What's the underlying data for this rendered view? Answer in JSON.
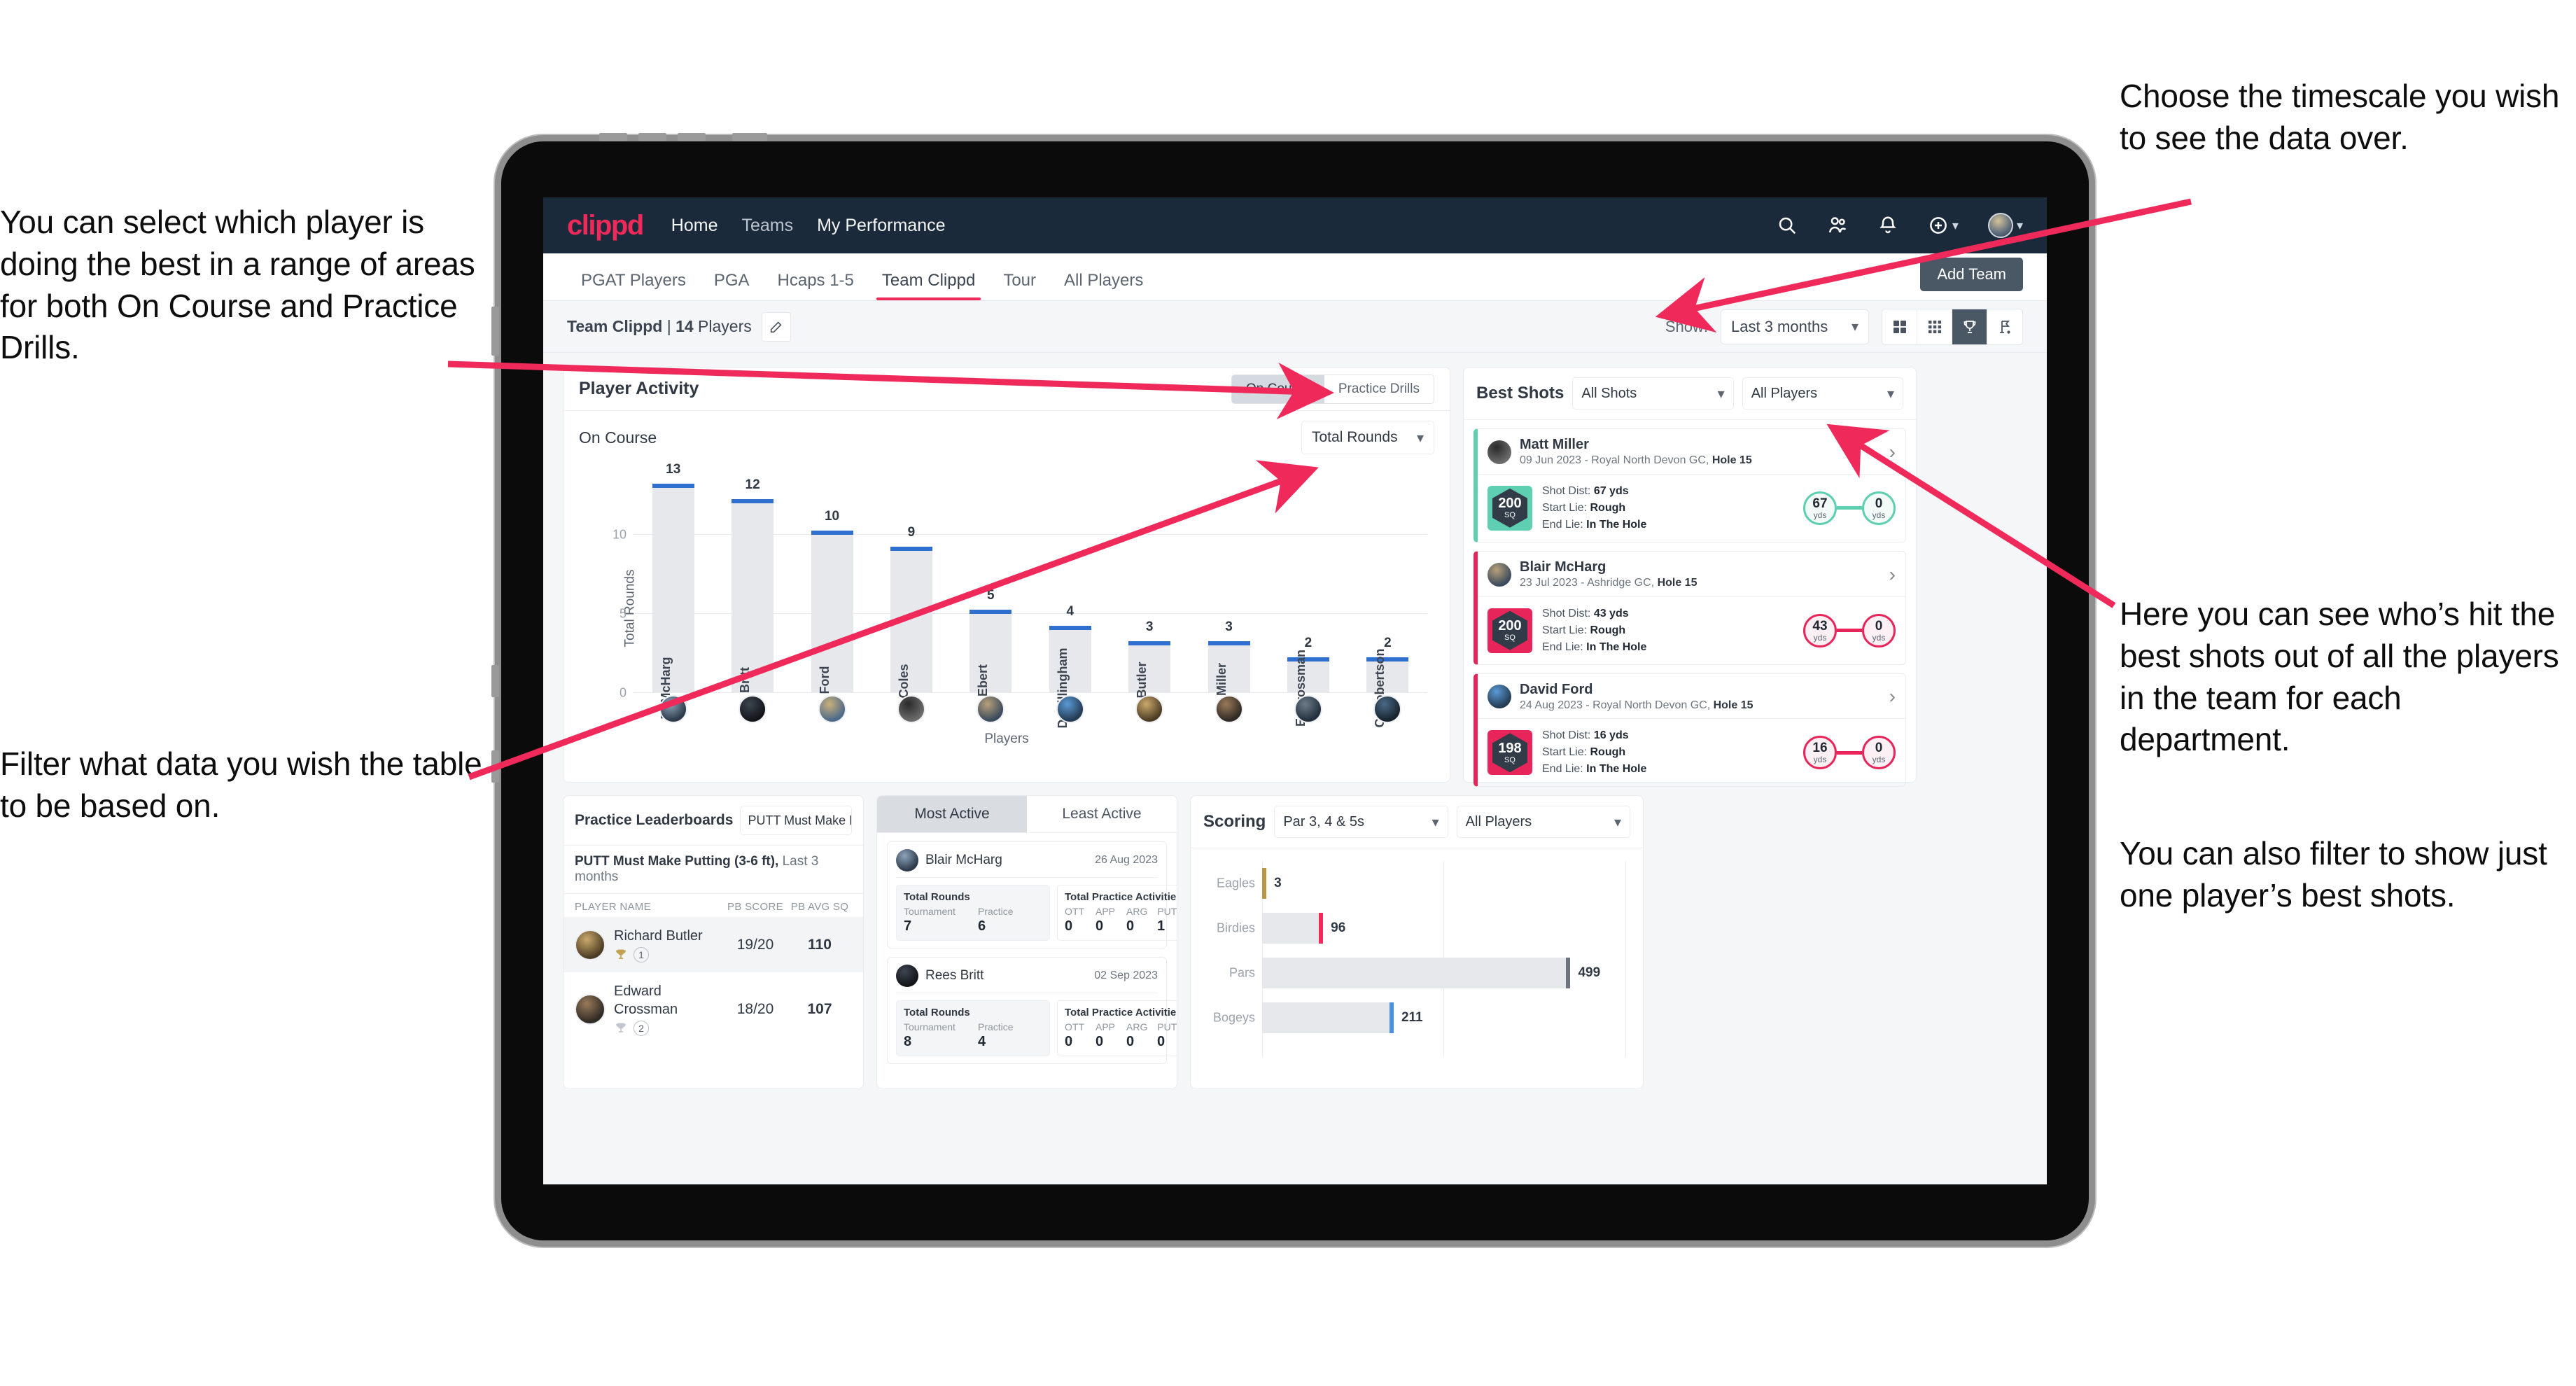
{
  "annotations": {
    "left_top": "You can select which player is doing the best in a range of areas for both On Course and Practice Drills.",
    "left_bottom": "Filter what data you wish the table to be based on.",
    "right_top": "Choose the timescale you wish to see the data over.",
    "right_middle": "Here you can see who’s hit the best shots out of all the players in the team for each department.",
    "right_bottom": "You can also filter to show just one player’s best shots."
  },
  "colors": {
    "brand_pink": "#ef2a5b",
    "navy": "#1b2a3a",
    "bar_blue": "#2f6fd0",
    "teal": "#5ecfb1",
    "gold": "#b99442",
    "slate": "#4a5764"
  },
  "topnav": {
    "logo": "clippd",
    "links": [
      "Home",
      "Teams",
      "My Performance"
    ],
    "icons": [
      "search-icon",
      "people-icon",
      "bell-icon",
      "add-circle-icon",
      "avatar-icon"
    ]
  },
  "tabs": {
    "items": [
      "PGAT Players",
      "PGA",
      "Hcaps 1-5",
      "Team Clippd",
      "Tour",
      "All Players"
    ],
    "active": "Team Clippd",
    "add_team_label": "Add Team"
  },
  "subbar": {
    "team_name": "Team Clippd",
    "team_divider": " | ",
    "player_count": "14",
    "players_word": " Players",
    "show_label": "Show:",
    "timescale_value": "Last 3 months",
    "view_icons": [
      "grid-large-icon",
      "grid-small-icon",
      "trophy-icon",
      "flag-icon"
    ],
    "view_active": "trophy-icon"
  },
  "player_activity": {
    "title": "Player Activity",
    "segments": [
      "On Course",
      "Practice Drills"
    ],
    "segment_active": "On Course",
    "sub_label": "On Course",
    "metric_value": "Total Rounds"
  },
  "chart_data": {
    "type": "bar",
    "title": "Player Activity — On Course",
    "xlabel": "Players",
    "ylabel": "Total Rounds",
    "ylim": [
      0,
      14
    ],
    "yticks": [
      0,
      5,
      10
    ],
    "grid": true,
    "categories": [
      "B. McHarg",
      "R. Britt",
      "D. Ford",
      "J. Coles",
      "E. Ebert",
      "D. Billingham",
      "R. Butler",
      "M. Miller",
      "E. Crossman",
      "C. Robertson"
    ],
    "values": [
      13,
      12,
      10,
      9,
      5,
      4,
      3,
      3,
      2,
      2
    ]
  },
  "best_shots": {
    "title": "Best Shots",
    "shot_filter": "All Shots",
    "player_filter": "All Players",
    "shots": [
      {
        "player": "Matt Miller",
        "meta_date": "09 Jun 2023 - Royal North Devon GC, ",
        "meta_hole": "Hole 15",
        "quality": "200",
        "quality_unit": "SQ",
        "shot_dist_label": "Shot Dist: ",
        "shot_dist": "67 yds",
        "start_lie_label": "Start Lie: ",
        "start_lie": "Rough",
        "end_lie_label": "End Lie: ",
        "end_lie": "In The Hole",
        "from_value": "67",
        "from_unit": "yds",
        "to_value": "0",
        "to_unit": "yds",
        "accent": "#5ecfb1"
      },
      {
        "player": "Blair McHarg",
        "meta_date": "23 Jul 2023 - Ashridge GC, ",
        "meta_hole": "Hole 15",
        "quality": "200",
        "quality_unit": "SQ",
        "shot_dist_label": "Shot Dist: ",
        "shot_dist": "43 yds",
        "start_lie_label": "Start Lie: ",
        "start_lie": "Rough",
        "end_lie_label": "End Lie: ",
        "end_lie": "In The Hole",
        "from_value": "43",
        "from_unit": "yds",
        "to_value": "0",
        "to_unit": "yds",
        "accent": "#e8255a"
      },
      {
        "player": "David Ford",
        "meta_date": "24 Aug 2023 - Royal North Devon GC, ",
        "meta_hole": "Hole 15",
        "quality": "198",
        "quality_unit": "SQ",
        "shot_dist_label": "Shot Dist: ",
        "shot_dist": "16 yds",
        "start_lie_label": "Start Lie: ",
        "start_lie": "Rough",
        "end_lie_label": "End Lie: ",
        "end_lie": "In The Hole",
        "from_value": "16",
        "from_unit": "yds",
        "to_value": "0",
        "to_unit": "yds",
        "accent": "#e8255a"
      }
    ]
  },
  "leaderboards": {
    "title": "Practice Leaderboards",
    "select_value": "PUTT Must Make Putting ...",
    "drill_name": "PUTT Must Make Putting (3-6 ft),",
    "drill_period": " Last 3 months",
    "columns": [
      "PLAYER NAME",
      "PB SCORE",
      "PB AVG SQ"
    ],
    "rows": [
      {
        "name": "Richard Butler",
        "rank": "1",
        "pb_score": "19/20",
        "pb_avg_sq": "110",
        "trophy": "gold"
      },
      {
        "name": "Edward Crossman",
        "rank": "2",
        "pb_score": "18/20",
        "pb_avg_sq": "107",
        "trophy": "silver"
      }
    ]
  },
  "activity": {
    "tabs": [
      "Most Active",
      "Least Active"
    ],
    "active_tab": "Most Active",
    "rounds_title": "Total Rounds",
    "rounds_labels": [
      "Tournament",
      "Practice"
    ],
    "practice_title": "Total Practice Activities",
    "practice_labels": [
      "OTT",
      "APP",
      "ARG",
      "PUTT"
    ],
    "cards": [
      {
        "name": "Blair McHarg",
        "date": "26 Aug 2023",
        "rounds": [
          "7",
          "6"
        ],
        "practice": [
          "0",
          "0",
          "0",
          "1"
        ]
      },
      {
        "name": "Rees Britt",
        "date": "02 Sep 2023",
        "rounds": [
          "8",
          "4"
        ],
        "practice": [
          "0",
          "0",
          "0",
          "0"
        ]
      }
    ]
  },
  "scoring": {
    "title": "Scoring",
    "par_filter": "Par 3, 4 & 5s",
    "player_filter": "All Players",
    "chart": {
      "type": "bar",
      "orientation": "horizontal",
      "categories": [
        "Eagles",
        "Birdies",
        "Pars",
        "Bogeys"
      ],
      "values": [
        3,
        96,
        499,
        211
      ],
      "xlim": [
        0,
        600
      ],
      "colors": [
        "#b99442",
        "#ef2a5b",
        "#6b7480",
        "#4a90e2"
      ]
    }
  }
}
